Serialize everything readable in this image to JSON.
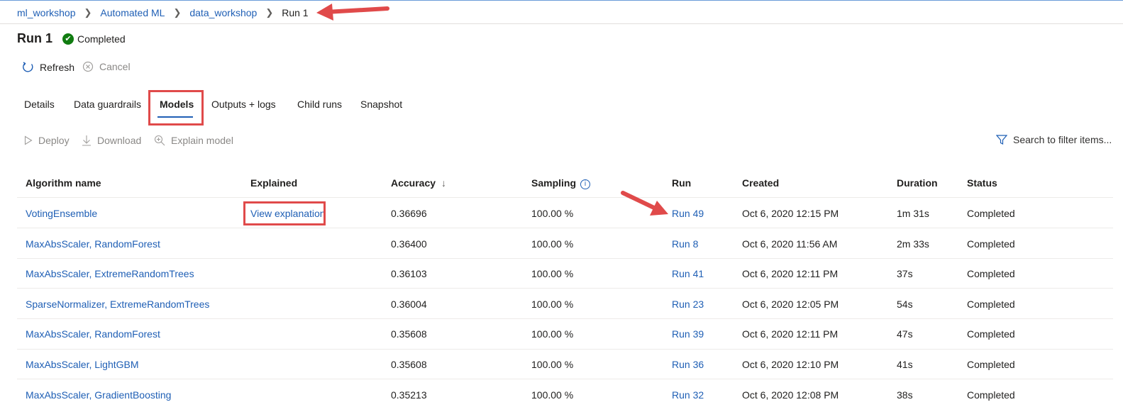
{
  "breadcrumb": {
    "items": [
      "ml_workshop",
      "Automated ML",
      "data_workshop"
    ],
    "current": "Run 1"
  },
  "run": {
    "title": "Run 1",
    "status": "Completed"
  },
  "actions": {
    "refresh": "Refresh",
    "cancel": "Cancel"
  },
  "tabs": [
    "Details",
    "Data guardrails",
    "Models",
    "Outputs + logs",
    "Child runs",
    "Snapshot"
  ],
  "active_tab": "Models",
  "toolbar": {
    "deploy": "Deploy",
    "download": "Download",
    "explain": "Explain model",
    "search_placeholder": "Search to filter items..."
  },
  "table": {
    "columns": [
      "Algorithm name",
      "Explained",
      "Accuracy",
      "Sampling",
      "Run",
      "Created",
      "Duration",
      "Status"
    ],
    "sort_indicator": "↓",
    "rows": [
      {
        "algorithm": "VotingEnsemble",
        "explained": "View explanation",
        "accuracy": "0.36696",
        "sampling": "100.00 %",
        "run": "Run 49",
        "created": "Oct 6, 2020 12:15 PM",
        "duration": "1m 31s",
        "status": "Completed"
      },
      {
        "algorithm": "MaxAbsScaler, RandomForest",
        "explained": "",
        "accuracy": "0.36400",
        "sampling": "100.00 %",
        "run": "Run 8",
        "created": "Oct 6, 2020 11:56 AM",
        "duration": "2m 33s",
        "status": "Completed"
      },
      {
        "algorithm": "MaxAbsScaler, ExtremeRandomTrees",
        "explained": "",
        "accuracy": "0.36103",
        "sampling": "100.00 %",
        "run": "Run 41",
        "created": "Oct 6, 2020 12:11 PM",
        "duration": "37s",
        "status": "Completed"
      },
      {
        "algorithm": "SparseNormalizer, ExtremeRandomTrees",
        "explained": "",
        "accuracy": "0.36004",
        "sampling": "100.00 %",
        "run": "Run 23",
        "created": "Oct 6, 2020 12:05 PM",
        "duration": "54s",
        "status": "Completed"
      },
      {
        "algorithm": "MaxAbsScaler, RandomForest",
        "explained": "",
        "accuracy": "0.35608",
        "sampling": "100.00 %",
        "run": "Run 39",
        "created": "Oct 6, 2020 12:11 PM",
        "duration": "47s",
        "status": "Completed"
      },
      {
        "algorithm": "MaxAbsScaler, LightGBM",
        "explained": "",
        "accuracy": "0.35608",
        "sampling": "100.00 %",
        "run": "Run 36",
        "created": "Oct 6, 2020 12:10 PM",
        "duration": "41s",
        "status": "Completed"
      },
      {
        "algorithm": "MaxAbsScaler, GradientBoosting",
        "explained": "",
        "accuracy": "0.35213",
        "sampling": "100.00 %",
        "run": "Run 32",
        "created": "Oct 6, 2020 12:08 PM",
        "duration": "38s",
        "status": "Completed"
      }
    ]
  },
  "colors": {
    "link": "#1f5fb5",
    "annotation": "#e04a4a",
    "success": "#107c10"
  },
  "icons": [
    "refresh-icon",
    "cancel-icon",
    "play-icon",
    "download-icon",
    "explain-icon",
    "filter-icon",
    "info-icon",
    "check-circle-icon"
  ]
}
